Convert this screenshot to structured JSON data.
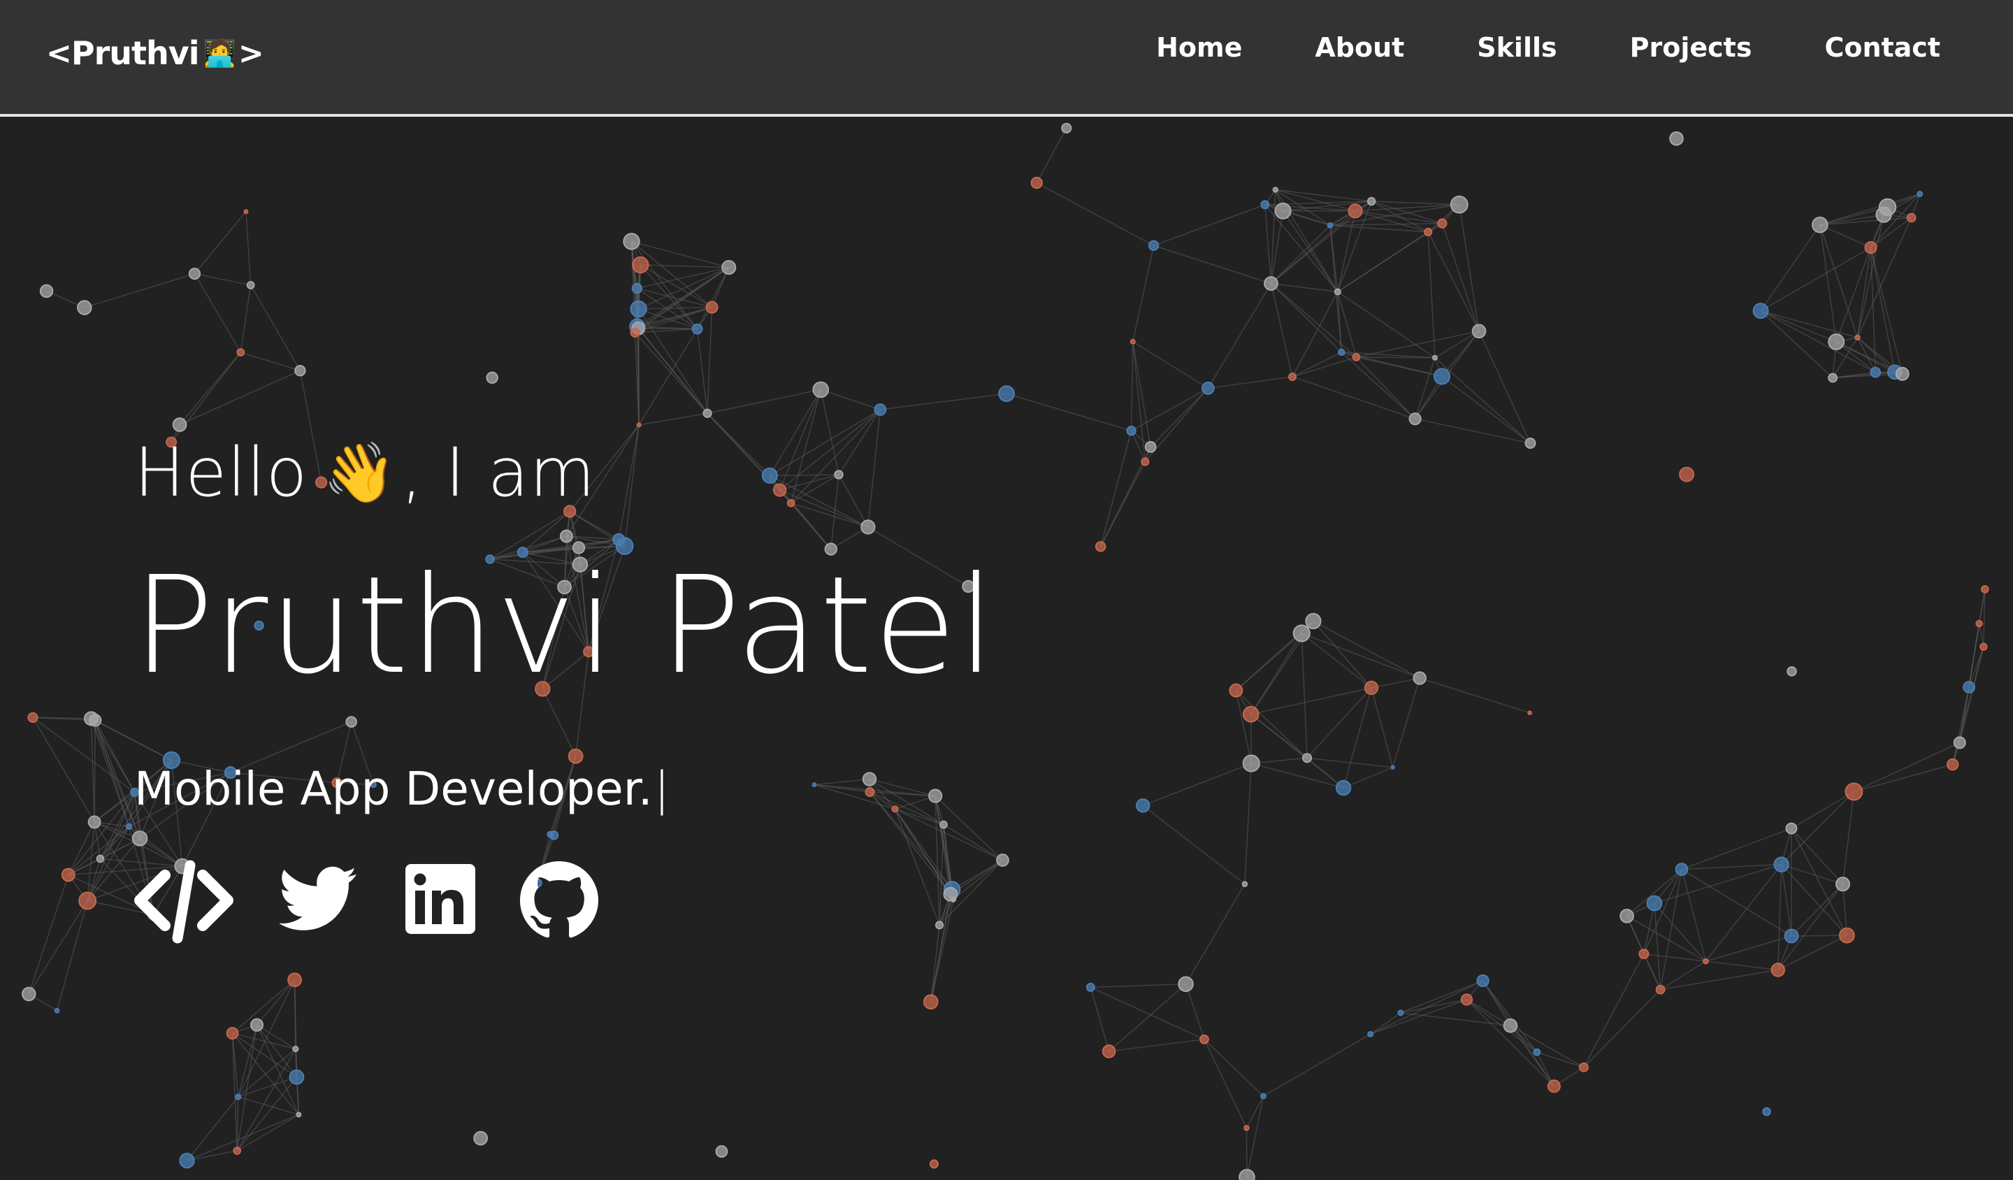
{
  "navbar": {
    "logo": {
      "open_bracket": "<",
      "name": "Pruthvi",
      "emoji": "🧑‍💻",
      "close_bracket": ">"
    },
    "links": [
      "Home",
      "About",
      "Skills",
      "Projects",
      "Contact"
    ]
  },
  "hero": {
    "greeting_prefix": "Hello",
    "greeting_emoji": "👋",
    "greeting_suffix": ", I am",
    "name": "Pruthvi Patel",
    "role": "Mobile App Developer.",
    "cursor": "|"
  },
  "socials": [
    {
      "icon": "code-icon",
      "label": "Portfolio"
    },
    {
      "icon": "twitter-icon",
      "label": "Twitter"
    },
    {
      "icon": "linkedin-icon",
      "label": "LinkedIn"
    },
    {
      "icon": "github-icon",
      "label": "GitHub"
    }
  ],
  "colors": {
    "background": "#212121",
    "navbar": "#333333",
    "text": "#ffffff",
    "particle_blue": "#4a7fb5",
    "particle_red": "#c8674d",
    "particle_gray": "#a8a8a8"
  }
}
